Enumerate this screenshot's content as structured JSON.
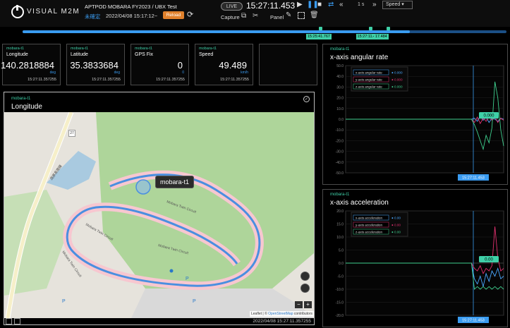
{
  "header": {
    "logo_text": "VISUAL M2M",
    "project_title": "APTPOD MOBARA FY2023 / UBX Test",
    "live_status": "未確定",
    "measurement_time": "2022/04/08 15:17:12~",
    "reload_label": "Reload",
    "live_label": "LIVE",
    "clock": "15:27:11.453",
    "step_label": "1 s",
    "speed_label": "Speed",
    "capture_label": "Capture",
    "panel_label": "Panel"
  },
  "timeline": {
    "progress": 0.8,
    "markers": [
      {
        "label": "15:25:41.767",
        "pos": 0.615
      },
      {
        "label": "15:27:11.453",
        "pos": 0.718
      },
      {
        "label": "17.484",
        "pos": 0.755
      }
    ]
  },
  "cards": [
    {
      "source": "mobara-t1",
      "name": "Longitude",
      "value": "140.2818884",
      "unit": "deg",
      "timestamp": "15:27:11.357255"
    },
    {
      "source": "mobara-t1",
      "name": "Latitude",
      "value": "35.3833684",
      "unit": "deg",
      "timestamp": "15:27:11.357255"
    },
    {
      "source": "mobara-t1",
      "name": "GPS Fix",
      "value": "0",
      "unit": "0",
      "timestamp": "15:27:11.357255"
    },
    {
      "source": "mobara-t1",
      "name": "Speed",
      "value": "49.489",
      "unit": "km/h",
      "timestamp": "15:27:11.357255"
    }
  ],
  "map_panel": {
    "source": "mobara-t1",
    "title": "Longitude",
    "tooltip": "mobara-t1",
    "road_label": "茂原長南線",
    "route_number": "27",
    "circuit_label": "Mobara Twin Circuit",
    "attribution_prefix": "Leaflet | © ",
    "attribution_link": "OpenStreetMap",
    "attribution_suffix": " contributors",
    "timestamp": "2022/04/08 15:27:11.357255",
    "zoom_in": "+",
    "zoom_out": "−",
    "poi_label": "P"
  },
  "colors": {
    "accent_blue": "#3a9bf0",
    "accent_teal": "#3fd0a8",
    "reload_orange": "#e0812c",
    "series_x": "#4aa8ff",
    "series_y": "#e0306e",
    "series_z": "#3ecf8e"
  },
  "chart_data": [
    {
      "type": "line",
      "source": "mobara-t1",
      "title": "x-axis angular rate",
      "ylim": [
        -50,
        50
      ],
      "yticks": [
        "50.0",
        "40.0",
        "30.0",
        "20.0",
        "10.0",
        "0.0",
        "-10.0",
        "-20.0",
        "-30.0",
        "-40.0",
        "-50.0"
      ],
      "current_value": "0.000",
      "cursor_time": "15:27:11.453",
      "legend_location": "top-left",
      "series": [
        {
          "name": "x-axis angular rate",
          "current": "0.000",
          "values": [
            0,
            0,
            0,
            0,
            0,
            0,
            0,
            0,
            0,
            0,
            0,
            0,
            0,
            0,
            0,
            0,
            0,
            0,
            0,
            0,
            0,
            0,
            0,
            0,
            0,
            0,
            0,
            0,
            0,
            0,
            0,
            0,
            0,
            0,
            0,
            0,
            0,
            0,
            0,
            0,
            0,
            0,
            0,
            0,
            1,
            -2,
            3,
            -1,
            2,
            -3,
            1,
            0,
            -2,
            1,
            0
          ]
        },
        {
          "name": "y-axis angular rate",
          "current": "0.000",
          "values": [
            0,
            0,
            0,
            0,
            0,
            0,
            0,
            0,
            0,
            0,
            0,
            0,
            0,
            0,
            0,
            0,
            0,
            0,
            0,
            0,
            0,
            0,
            0,
            0,
            0,
            0,
            0,
            0,
            0,
            0,
            0,
            0,
            0,
            0,
            0,
            0,
            0,
            0,
            0,
            0,
            0,
            0,
            0,
            0,
            -3,
            2,
            -4,
            1,
            -2,
            3,
            -1,
            2,
            -3,
            1,
            -1
          ]
        },
        {
          "name": "z-axis angular rate",
          "current": "0.000",
          "values": [
            0,
            0,
            0,
            0,
            0,
            0,
            0,
            0,
            0,
            0,
            0,
            0,
            0,
            0,
            0,
            0,
            0,
            0,
            0,
            0,
            0,
            0,
            0,
            0,
            0,
            0,
            0,
            0,
            0,
            0,
            0,
            0,
            0,
            0,
            0,
            0,
            0,
            0,
            0,
            0,
            0,
            0,
            0,
            0,
            -5,
            -12,
            -20,
            -28,
            -15,
            -22,
            -8,
            35,
            20,
            -10,
            -25
          ]
        }
      ]
    },
    {
      "type": "line",
      "source": "mobara-t1",
      "title": "x-axis acceleration",
      "ylim": [
        -20,
        20
      ],
      "yticks": [
        "20.0",
        "15.0",
        "10.0",
        "5.0",
        "0.0",
        "-5.0",
        "-10.0",
        "-15.0",
        "-20.0"
      ],
      "current_value": "0.00",
      "cursor_time": "15:27:11.453",
      "legend_location": "top-left",
      "series": [
        {
          "name": "x-axis acceleration",
          "current": "0.00",
          "values": [
            0,
            0,
            0,
            0,
            0,
            0,
            0,
            0,
            0,
            0,
            0,
            0,
            0,
            0,
            0,
            0,
            0,
            0,
            0,
            0,
            0,
            0,
            0,
            0,
            0,
            0,
            0,
            0,
            0,
            0,
            0,
            0,
            0,
            0,
            0,
            0,
            0,
            0,
            0,
            0,
            0,
            0,
            0,
            0,
            -6,
            -8,
            -5,
            -9,
            -4,
            -7,
            -3,
            -5,
            -2,
            -6,
            -5
          ]
        },
        {
          "name": "y-axis acceleration",
          "current": "0.00",
          "values": [
            0,
            0,
            0,
            0,
            0,
            0,
            0,
            0,
            0,
            0,
            0,
            0,
            0,
            0,
            0,
            0,
            0,
            0,
            0,
            0,
            0,
            0,
            0,
            0,
            0,
            0,
            0,
            0,
            0,
            0,
            0,
            0,
            0,
            0,
            0,
            0,
            0,
            0,
            0,
            0,
            0,
            0,
            0,
            0,
            -2,
            -3,
            -1,
            -4,
            -2,
            -3,
            -1,
            14,
            2,
            -3,
            -2
          ]
        },
        {
          "name": "z-axis acceleration",
          "current": "0.00",
          "values": [
            0,
            0,
            0,
            0,
            0,
            0,
            0,
            0,
            0,
            0,
            0,
            0,
            0,
            0,
            0,
            0,
            0,
            0,
            0,
            0,
            0,
            0,
            0,
            0,
            0,
            0,
            0,
            0,
            0,
            0,
            0,
            0,
            0,
            0,
            0,
            0,
            0,
            0,
            0,
            0,
            0,
            0,
            0,
            0,
            -10,
            -9,
            -10,
            -9,
            -10,
            -9,
            -10,
            -9,
            -10,
            -9,
            -10
          ]
        }
      ]
    }
  ]
}
